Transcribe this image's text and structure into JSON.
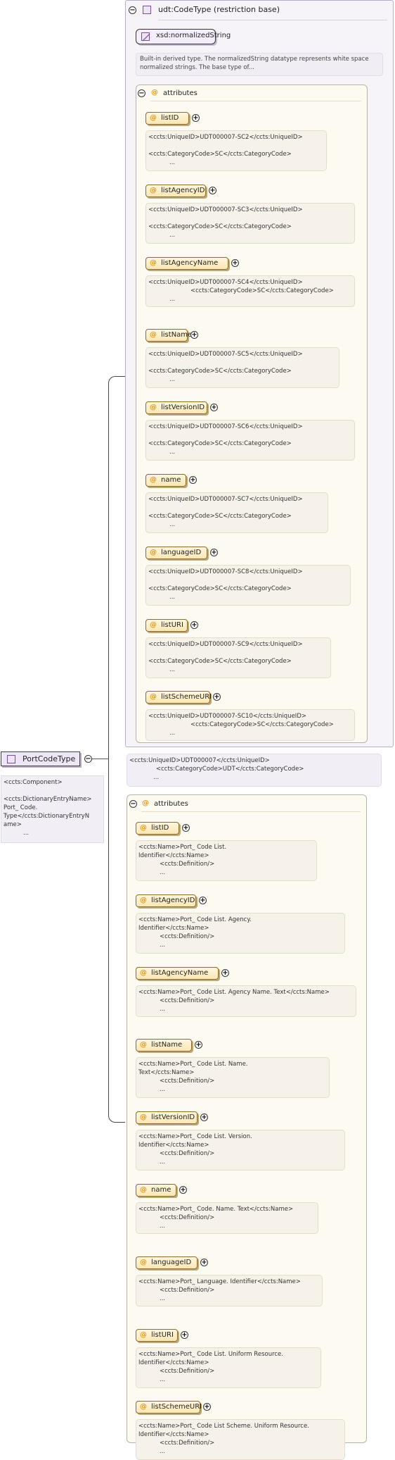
{
  "root": {
    "name": "PortCodeType",
    "note_lines": [
      "<ccts:Component>",
      "",
      "<ccts:DictionaryEntryName>",
      "Port_ Code.",
      "Type</ccts:DictionaryEntryN",
      "ame>",
      "..."
    ]
  },
  "base_type": {
    "header": "udt:CodeType (restriction base)",
    "base_name": "xsd:normalizedString",
    "description": "Built-in derived type. The normalizedString datatype represents white space normalized strings. The base type of...",
    "attributes_label": "attributes",
    "attributes": [
      {
        "name": "listID",
        "note": [
          "<ccts:UniqueID>UDT000007-SC2</ccts:UniqueID>",
          "",
          "<ccts:CategoryCode>SC</ccts:CategoryCode>",
          "..."
        ]
      },
      {
        "name": "listAgencyID",
        "note": [
          "<ccts:UniqueID>UDT000007-SC3</ccts:UniqueID>",
          "",
          "<ccts:CategoryCode>SC</ccts:CategoryCode>",
          "..."
        ]
      },
      {
        "name": "listAgencyName",
        "note": [
          "<ccts:UniqueID>UDT000007-SC4</ccts:UniqueID>",
          "<ccts:CategoryCode>SC</ccts:CategoryCode>",
          "..."
        ]
      },
      {
        "name": "listName",
        "note": [
          "<ccts:UniqueID>UDT000007-SC5</ccts:UniqueID>",
          "",
          "<ccts:CategoryCode>SC</ccts:CategoryCode>",
          "..."
        ]
      },
      {
        "name": "listVersionID",
        "note": [
          "<ccts:UniqueID>UDT000007-SC6</ccts:UniqueID>",
          "",
          "<ccts:CategoryCode>SC</ccts:CategoryCode>",
          "..."
        ]
      },
      {
        "name": "name",
        "note": [
          "<ccts:UniqueID>UDT000007-SC7</ccts:UniqueID>",
          "",
          "<ccts:CategoryCode>SC</ccts:CategoryCode>",
          "..."
        ]
      },
      {
        "name": "languageID",
        "note": [
          "<ccts:UniqueID>UDT000007-SC8</ccts:UniqueID>",
          "",
          "<ccts:CategoryCode>SC</ccts:CategoryCode>",
          "..."
        ]
      },
      {
        "name": "listURI",
        "note": [
          "<ccts:UniqueID>UDT000007-SC9</ccts:UniqueID>",
          "",
          "<ccts:CategoryCode>SC</ccts:CategoryCode>",
          "..."
        ]
      },
      {
        "name": "listSchemeURI",
        "note": [
          "<ccts:UniqueID>UDT000007-SC10</ccts:UniqueID>",
          "<ccts:CategoryCode>SC</ccts:CategoryCode>",
          "..."
        ]
      }
    ]
  },
  "type_note": [
    "<ccts:UniqueID>UDT000007</ccts:UniqueID>",
    "<ccts:CategoryCode>UDT</ccts:CategoryCode>",
    "..."
  ],
  "own_attributes": {
    "label": "attributes",
    "items": [
      {
        "name": "listID",
        "note": [
          "<ccts:Name>Port_ Code List.",
          "Identifier</ccts:Name>",
          "<ccts:Definition/>",
          "..."
        ]
      },
      {
        "name": "listAgencyID",
        "note": [
          "<ccts:Name>Port_ Code List. Agency.",
          "Identifier</ccts:Name>",
          "<ccts:Definition/>",
          "..."
        ]
      },
      {
        "name": "listAgencyName",
        "note": [
          "<ccts:Name>Port_ Code List. Agency Name. Text</ccts:Name>",
          "<ccts:Definition/>",
          "..."
        ]
      },
      {
        "name": "listName",
        "note": [
          "<ccts:Name>Port_ Code List. Name.",
          "Text</ccts:Name>",
          "<ccts:Definition/>",
          "..."
        ]
      },
      {
        "name": "listVersionID",
        "note": [
          "<ccts:Name>Port_ Code List. Version.",
          "Identifier</ccts:Name>",
          "<ccts:Definition/>",
          "..."
        ]
      },
      {
        "name": "name",
        "note": [
          "<ccts:Name>Port_ Code. Name. Text</ccts:Name>",
          "<ccts:Definition/>",
          "..."
        ]
      },
      {
        "name": "languageID",
        "note": [
          "<ccts:Name>Port_ Language. Identifier</ccts:Name>",
          "<ccts:Definition/>",
          "..."
        ]
      },
      {
        "name": "listURI",
        "note": [
          "<ccts:Name>Port_ Code List. Uniform Resource.",
          "Identifier</ccts:Name>",
          "<ccts:Definition/>",
          "..."
        ]
      },
      {
        "name": "listSchemeURI",
        "note": [
          "<ccts:Name>Port_ Code List Scheme. Uniform Resource.",
          "Identifier</ccts:Name>",
          "<ccts:Definition/>",
          "..."
        ]
      }
    ]
  }
}
